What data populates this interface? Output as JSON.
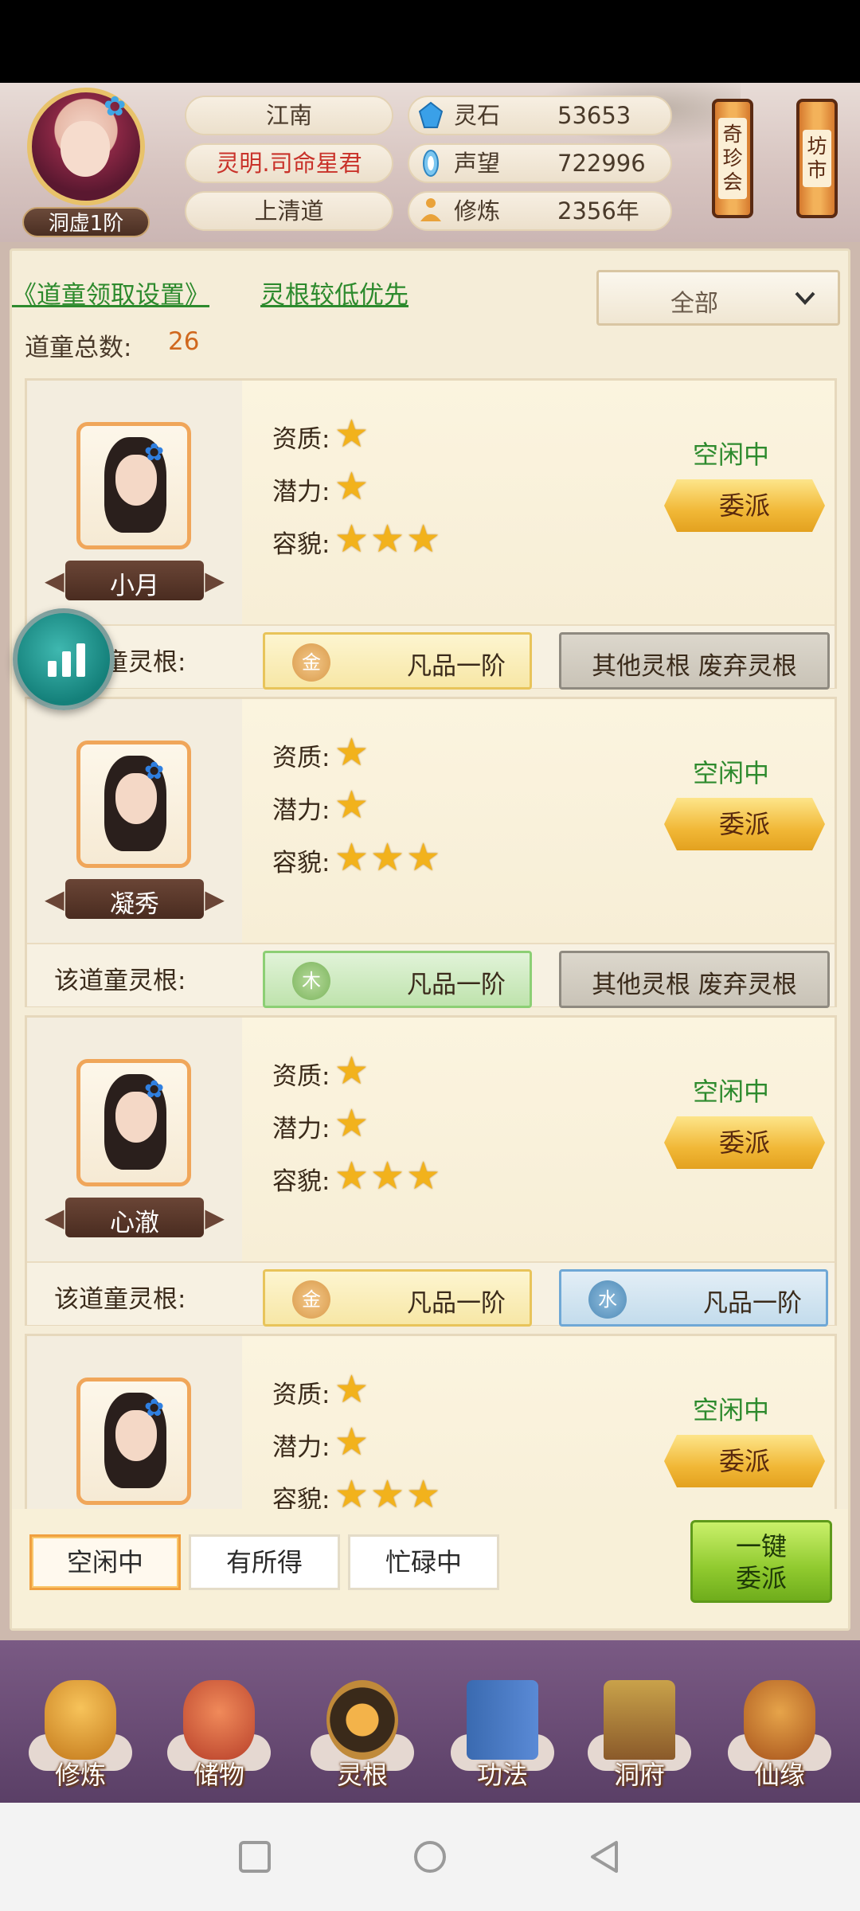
{
  "header": {
    "rank": "洞虚1阶",
    "place": "江南",
    "title": "灵明.司命星君",
    "sect": "上清道",
    "resources": [
      {
        "name": "灵石",
        "value": "53653",
        "icon": "spirit-stone-icon"
      },
      {
        "name": "声望",
        "value": "722996",
        "icon": "reputation-icon"
      },
      {
        "name": "修炼",
        "value": "2356年",
        "icon": "meditation-icon"
      }
    ],
    "lanterns": [
      {
        "label": [
          "奇",
          "珍",
          "会"
        ]
      },
      {
        "label": [
          "坊",
          "市"
        ]
      }
    ]
  },
  "controls": {
    "settings_link": "《道童领取设置》",
    "priority_link": "灵根较低优先",
    "filter_value": "全部",
    "total_label": "道童总数:",
    "total_value": "26"
  },
  "labels": {
    "aptitude": "资质:",
    "potential": "潜力:",
    "appearance": "容貌:",
    "root": "该道童灵根:",
    "assign": "委派"
  },
  "servants": [
    {
      "name": "小月",
      "status": "空闲中",
      "aptitude": 1,
      "potential": 1,
      "appearance": 3,
      "roots": [
        {
          "element": "金",
          "grade": "凡品一阶",
          "color": "gold"
        },
        {
          "text": "其他灵根 废弃灵根",
          "color": "gray"
        }
      ]
    },
    {
      "name": "凝秀",
      "status": "空闲中",
      "aptitude": 1,
      "potential": 1,
      "appearance": 3,
      "roots": [
        {
          "element": "木",
          "grade": "凡品一阶",
          "color": "green"
        },
        {
          "text": "其他灵根 废弃灵根",
          "color": "gray"
        }
      ]
    },
    {
      "name": "心澈",
      "status": "空闲中",
      "aptitude": 1,
      "potential": 1,
      "appearance": 3,
      "roots": [
        {
          "element": "金",
          "grade": "凡品一阶",
          "color": "gold"
        },
        {
          "element": "水",
          "grade": "凡品一阶",
          "color": "blue"
        }
      ]
    },
    {
      "name": "",
      "status": "空闲中",
      "aptitude": 1,
      "potential": 1,
      "appearance": 3,
      "roots": []
    }
  ],
  "tabs": [
    {
      "label": "空闲中",
      "active": true
    },
    {
      "label": "有所得",
      "active": false
    },
    {
      "label": "忙碌中",
      "active": false
    }
  ],
  "auto_assign": [
    "一键",
    "委派"
  ],
  "nav": [
    {
      "label": "修炼",
      "icon": "cultivate-icon"
    },
    {
      "label": "储物",
      "icon": "storage-bag-icon"
    },
    {
      "label": "灵根",
      "icon": "spirit-root-icon"
    },
    {
      "label": "功法",
      "icon": "technique-book-icon"
    },
    {
      "label": "洞府",
      "icon": "cave-dwelling-icon"
    },
    {
      "label": "仙缘",
      "icon": "immortal-fate-icon"
    }
  ],
  "colors": {
    "status_green": "#2d8a2d",
    "value_orange": "#d0681e",
    "title_red": "#c9322a",
    "star": "#f2b21c"
  }
}
